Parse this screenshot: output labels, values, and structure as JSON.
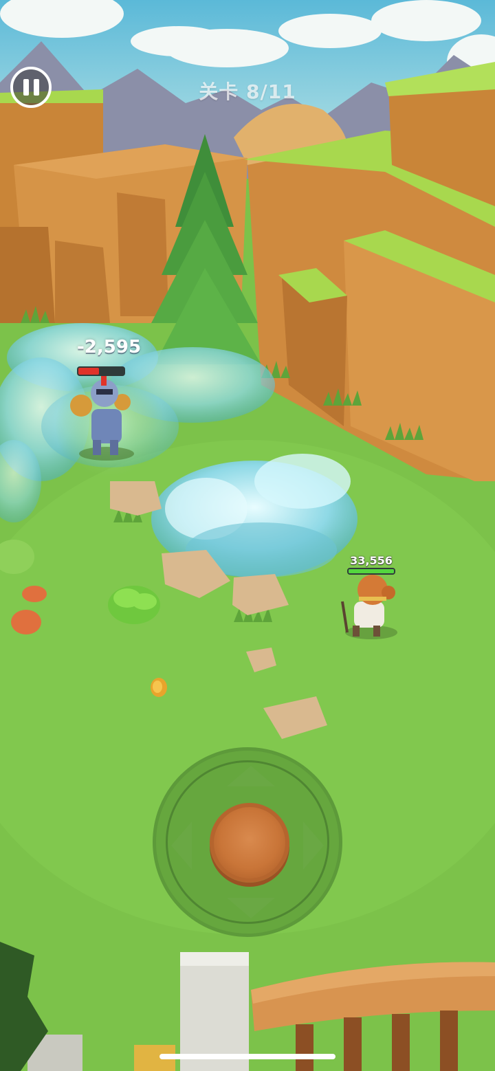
{
  "hud": {
    "level_text": "关卡 8/11",
    "pause_icon": "pause-icon"
  },
  "enemy": {
    "damage_text": "-2,595",
    "health_fraction": 0.45
  },
  "player": {
    "health_text": "33,556",
    "health_fraction": 1.0
  },
  "controls": {
    "joystick_icon": "dpad-joystick-icon",
    "arrows": [
      "up",
      "down",
      "left",
      "right"
    ]
  },
  "colors": {
    "grass": "#7cc24a",
    "cliff": "#d08a3e",
    "cliff_top": "#a8d84e",
    "frost": "#bfeff5",
    "enemy_hp": "#e0332a",
    "player_hp": "#54d63e",
    "joystick_knob": "#c97538"
  }
}
